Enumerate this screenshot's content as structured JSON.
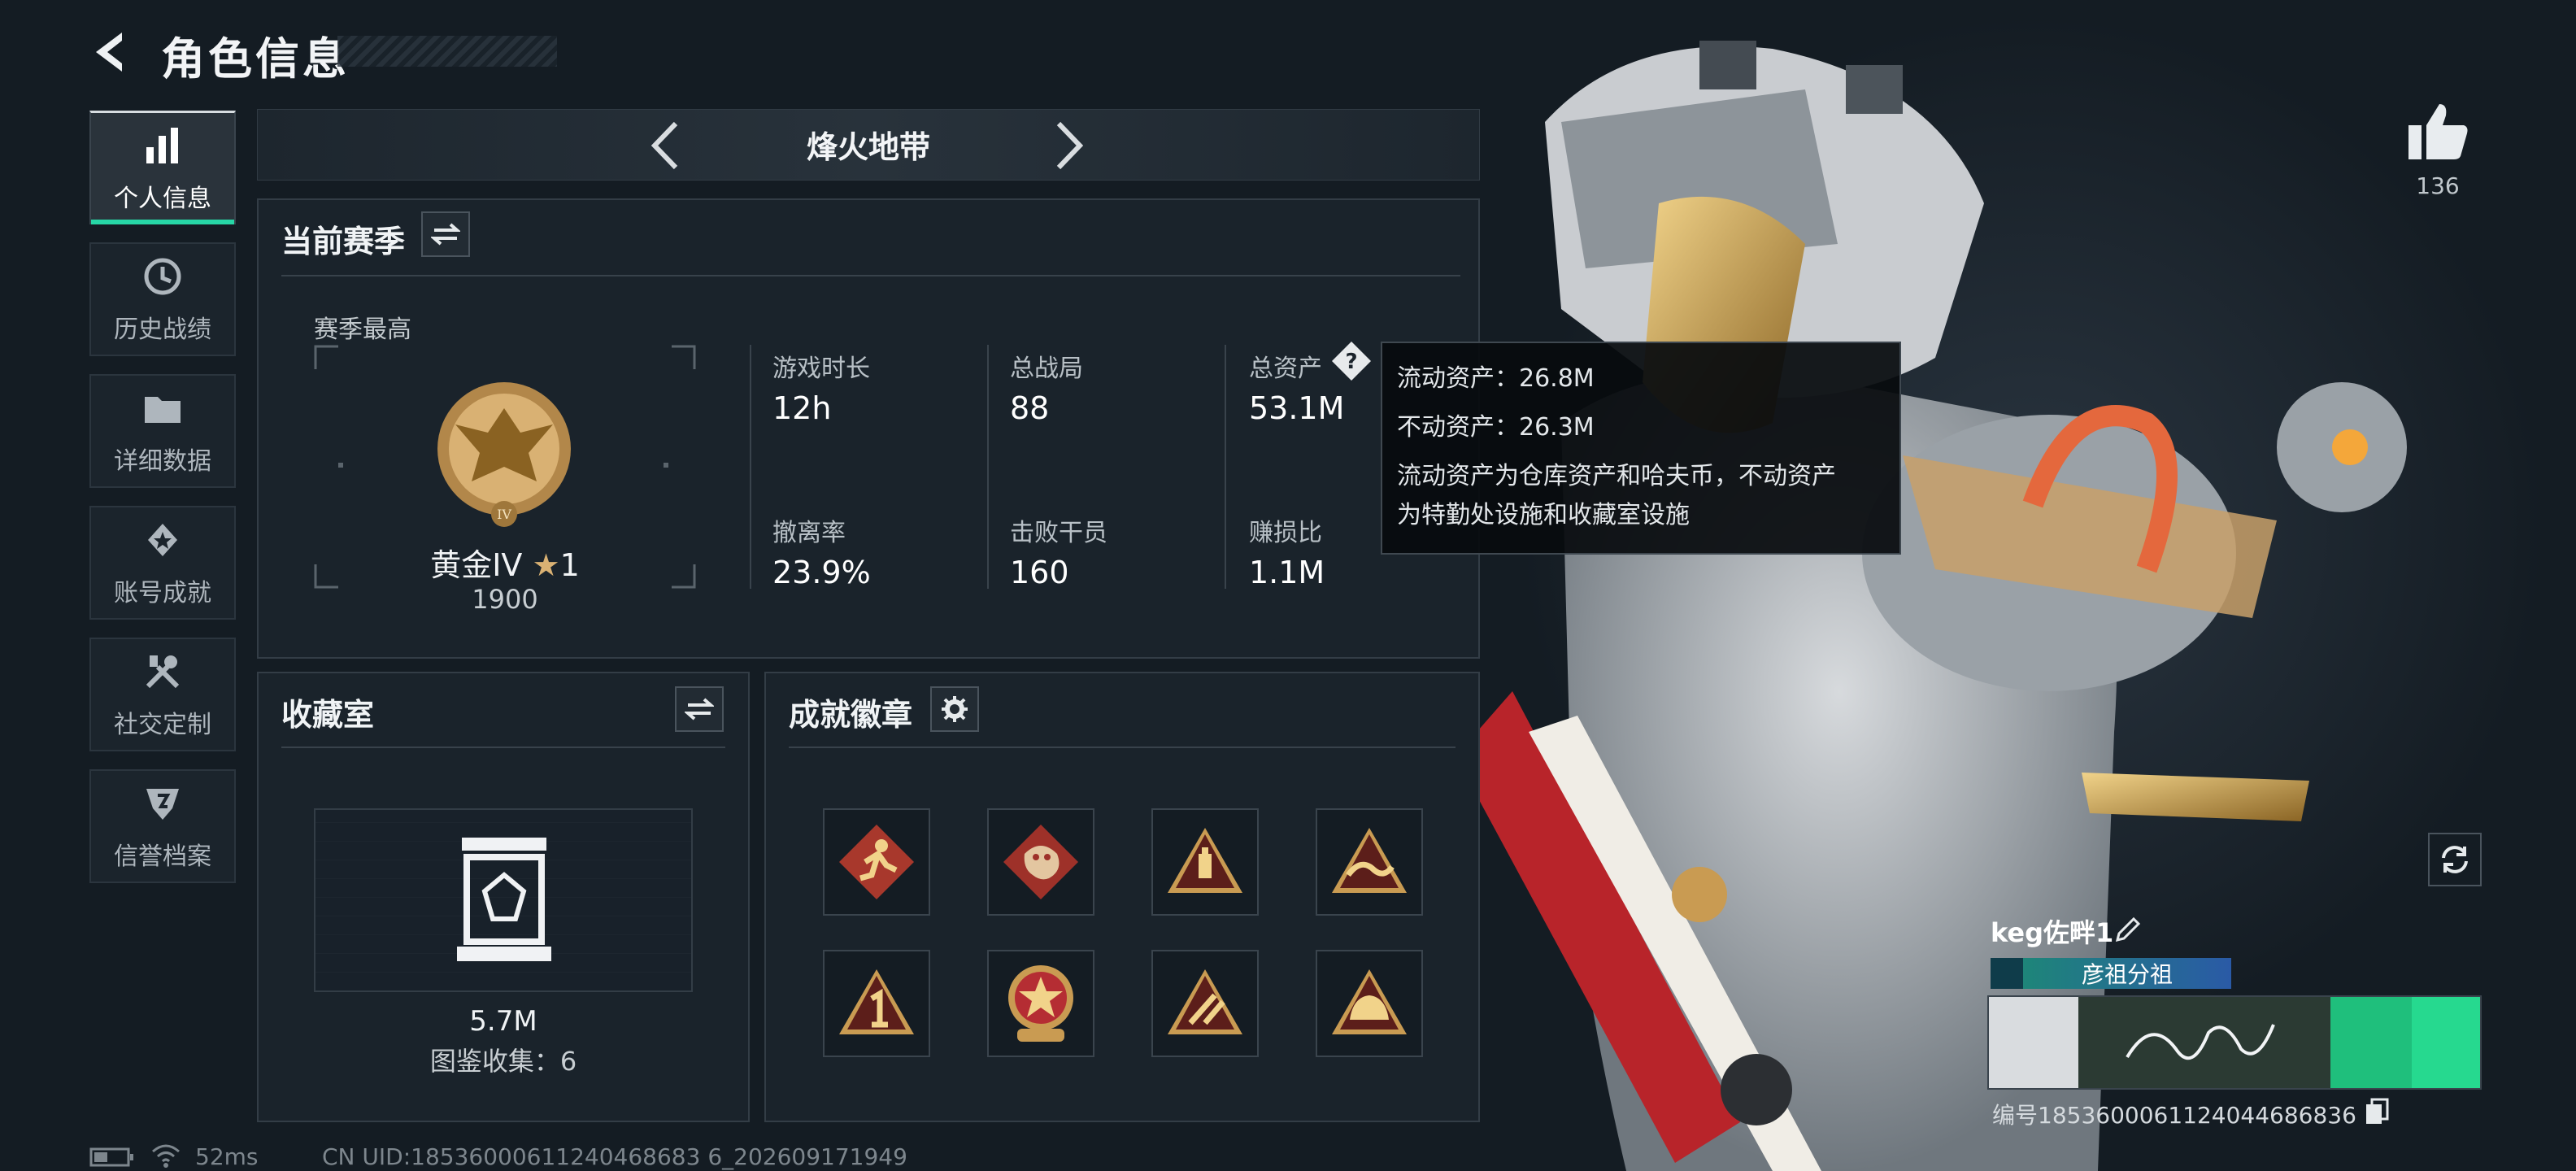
{
  "header": {
    "title": "角色信息"
  },
  "sidebar": {
    "items": [
      {
        "label": "个人信息",
        "icon": "bar-chart-icon",
        "active": true
      },
      {
        "label": "历史战绩",
        "icon": "history-clock-icon"
      },
      {
        "label": "详细数据",
        "icon": "folder-icon"
      },
      {
        "label": "账号成就",
        "icon": "achievement-star-icon"
      },
      {
        "label": "社交定制",
        "icon": "wrench-screwdriver-icon"
      },
      {
        "label": "信誉档案",
        "icon": "shield-emblem-icon"
      }
    ]
  },
  "mode_bar": {
    "title": "烽火地带"
  },
  "season": {
    "title": "当前赛季",
    "best_label": "赛季最高",
    "rank_name": "黄金IV",
    "rank_stars": "1",
    "rank_roman": "IV",
    "rank_score": "1900",
    "stats": [
      {
        "label": "游戏时长",
        "value": "12h"
      },
      {
        "label": "总战局",
        "value": "88"
      },
      {
        "label": "总资产",
        "value": "53.1M"
      },
      {
        "label": "撤离率",
        "value": "23.9%"
      },
      {
        "label": "击败干员",
        "value": "160"
      },
      {
        "label": "赚损比",
        "value": "1.1M"
      }
    ]
  },
  "tooltip": {
    "liquid": "流动资产：26.8M",
    "fixed": "不动资产：26.3M",
    "desc_line1": "流动资产为仓库资产和哈夫币，不动资产",
    "desc_line2": "为特勤处设施和收藏室设施"
  },
  "collection": {
    "title": "收藏室",
    "value": "5.7M",
    "collect_label": "图鉴收集：6"
  },
  "achievements": {
    "title": "成就徽章",
    "badges": [
      {
        "icon": "runner-badge-icon",
        "color": "#b8412f"
      },
      {
        "icon": "dragon-badge-icon",
        "color": "#a8382c"
      },
      {
        "icon": "triangle-usb-badge-icon",
        "color": "#c99b52"
      },
      {
        "icon": "triangle-wave-badge-icon",
        "color": "#c99b52"
      },
      {
        "icon": "triangle-number-one-badge-icon",
        "color": "#c99b52"
      },
      {
        "icon": "star-medal-badge-icon",
        "color": "#c42f35"
      },
      {
        "icon": "triangle-rocket-badge-icon",
        "color": "#c99b52"
      },
      {
        "icon": "triangle-helmet-badge-icon",
        "color": "#c99b52"
      }
    ]
  },
  "profile": {
    "likes": "136",
    "name": "keg佐畔1",
    "group": "彦祖分祖",
    "id_label": "编号1853600061124044686836"
  },
  "footer": {
    "ping": "52ms",
    "uid": "CN UID:18536000611240468683 6_202609171949"
  },
  "colors": {
    "accent": "#27d6a6",
    "gold": "#c99b52"
  }
}
